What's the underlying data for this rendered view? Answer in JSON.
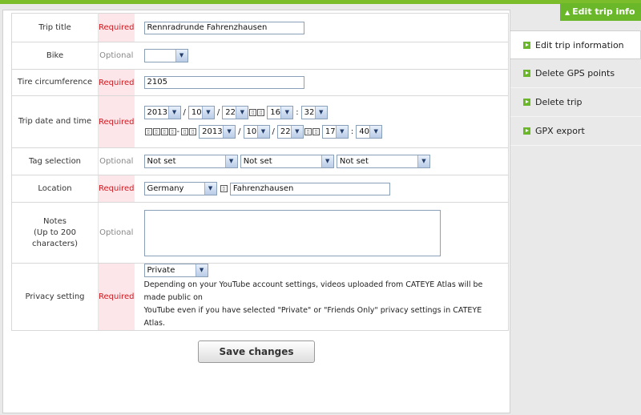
{
  "header": {
    "edit_tab_label": "Edit trip info"
  },
  "sidebar": {
    "items": [
      {
        "label": "Edit trip information",
        "active": true
      },
      {
        "label": "Delete GPS points"
      },
      {
        "label": "Delete trip"
      },
      {
        "label": "GPX export"
      }
    ]
  },
  "form": {
    "trip_title": {
      "label": "Trip title",
      "status": "Required",
      "value": "Rennradrunde Fahrenzhausen"
    },
    "bike": {
      "label": "Bike",
      "status": "Optional",
      "value": ""
    },
    "tire": {
      "label": "Tire circumference",
      "status": "Required",
      "value": "2105"
    },
    "datetime": {
      "label": "Trip date and time",
      "status": "Required",
      "start": {
        "year": "2013",
        "month": "10",
        "day": "22",
        "hour": "16",
        "minute": "32"
      },
      "end": {
        "year": "2013",
        "month": "10",
        "day": "22",
        "hour": "17",
        "minute": "40"
      },
      "sep_slash": "/",
      "sep_colon": ":",
      "sep_dash": "-"
    },
    "tags": {
      "label": "Tag selection",
      "status": "Optional",
      "values": [
        "Not set",
        "Not set",
        "Not set"
      ]
    },
    "location": {
      "label": "Location",
      "status": "Required",
      "country": "Germany",
      "place": "Fahrenzhausen"
    },
    "notes": {
      "label": "Notes",
      "sublabel": "(Up to 200 characters)",
      "status": "Optional",
      "value": ""
    },
    "privacy": {
      "label": "Privacy setting",
      "status": "Required",
      "value": "Private",
      "note_line1": "Depending on your YouTube account settings, videos uploaded from CATEYE Atlas will be made public on",
      "note_line2": "YouTube even if you have selected \"Private\" or \"Friends Only\" privacy settings in CATEYE Atlas."
    }
  },
  "save_label": "Save changes",
  "colors": {
    "accent_green": "#6ab82a",
    "required_red": "#cc1b22",
    "required_bg": "#fde6e9"
  }
}
